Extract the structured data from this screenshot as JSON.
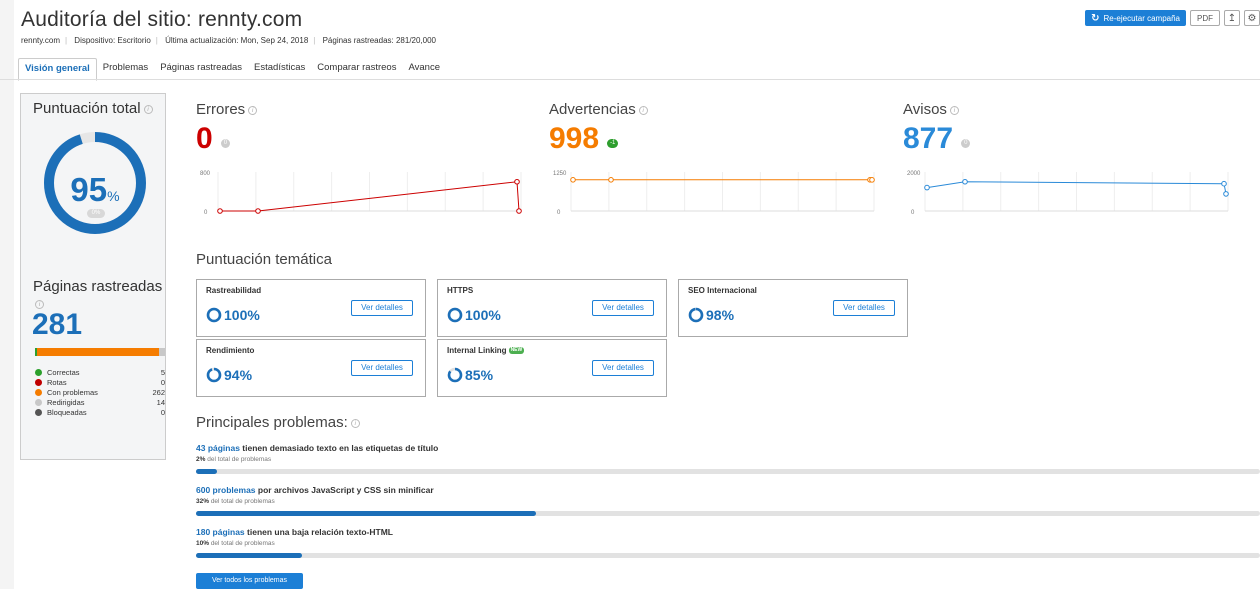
{
  "header": {
    "title": "Auditoría del sitio: rennty.com",
    "domain": "rennty.com",
    "device": "Dispositivo: Escritorio",
    "updated": "Última actualización: Mon, Sep 24, 2018",
    "pages_crawled": "Páginas rastreadas: 281/20,000",
    "rerun_label": "Re-ejecutar campaña",
    "pdf_label": "PDF"
  },
  "tabs": [
    {
      "label": "Visión general"
    },
    {
      "label": "Problemas"
    },
    {
      "label": "Páginas rastreadas"
    },
    {
      "label": "Estadísticas"
    },
    {
      "label": "Comparar rastreos"
    },
    {
      "label": "Avance"
    }
  ],
  "total_score": {
    "title": "Puntuación total",
    "value": "95",
    "unit": "%",
    "change": "0%",
    "fraction": 0.95
  },
  "crawled_pages": {
    "title": "Páginas rastreadas",
    "count": "281",
    "legend": [
      {
        "label": "Correctas",
        "value": "5",
        "color": "#2ca02c"
      },
      {
        "label": "Rotas",
        "value": "0",
        "color": "#c00000"
      },
      {
        "label": "Con problemas",
        "value": "262",
        "color": "#f57c00"
      },
      {
        "label": "Redirigidas",
        "value": "14",
        "color": "#c8c8c8"
      },
      {
        "label": "Bloqueadas",
        "value": "0",
        "color": "#555555"
      }
    ]
  },
  "metrics": {
    "errors": {
      "title": "Errores",
      "value": "0",
      "badge": "0",
      "color": "#cc0000",
      "badge_color": "#cccccc",
      "ymax": "800",
      "ymin": "0"
    },
    "warnings": {
      "title": "Advertencias",
      "value": "998",
      "badge": "-1",
      "color": "#f57c00",
      "badge_color": "#2e9e2e",
      "ymax": "1250",
      "ymin": "0"
    },
    "notices": {
      "title": "Avisos",
      "value": "877",
      "badge": "0",
      "color": "#2a8ad8",
      "badge_color": "#cccccc",
      "ymax": "2000",
      "ymin": "0"
    }
  },
  "chart_data": [
    {
      "type": "line",
      "title": "Errores",
      "ylim": [
        0,
        800
      ],
      "values": [
        0,
        0,
        600,
        0
      ]
    },
    {
      "type": "line",
      "title": "Advertencias",
      "ylim": [
        0,
        1250
      ],
      "values": [
        1000,
        1000,
        1000,
        998
      ]
    },
    {
      "type": "line",
      "title": "Avisos",
      "ylim": [
        0,
        2000
      ],
      "values": [
        1200,
        1500,
        1400,
        877
      ]
    }
  ],
  "thematic": {
    "title": "Puntuación temática",
    "details_label": "Ver detalles",
    "cards": [
      {
        "name": "Rastreabilidad",
        "value": "100%",
        "fraction": 1.0,
        "new": ""
      },
      {
        "name": "HTTPS",
        "value": "100%",
        "fraction": 1.0,
        "new": ""
      },
      {
        "name": "SEO Internacional",
        "value": "98%",
        "fraction": 0.98,
        "new": ""
      },
      {
        "name": "Rendimiento",
        "value": "94%",
        "fraction": 0.94,
        "new": ""
      },
      {
        "name": "Internal Linking",
        "value": "85%",
        "fraction": 0.85,
        "new": "NEW"
      }
    ]
  },
  "top_issues": {
    "title": "Principales problemas:",
    "items": [
      {
        "link": "43 páginas",
        "text": " tienen demasiado texto en las etiquetas de título",
        "pct": "2%",
        "suffix": " del total de problemas",
        "fraction": 0.02
      },
      {
        "link": "600 problemas",
        "text": " por archivos JavaScript y CSS sin minificar",
        "pct": "32%",
        "suffix": " del total de problemas",
        "fraction": 0.32
      },
      {
        "link": "180 páginas",
        "text": " tienen una baja relación texto-HTML",
        "pct": "10%",
        "suffix": " del total de problemas",
        "fraction": 0.1
      }
    ],
    "all_label": "Ver todos los problemas"
  }
}
